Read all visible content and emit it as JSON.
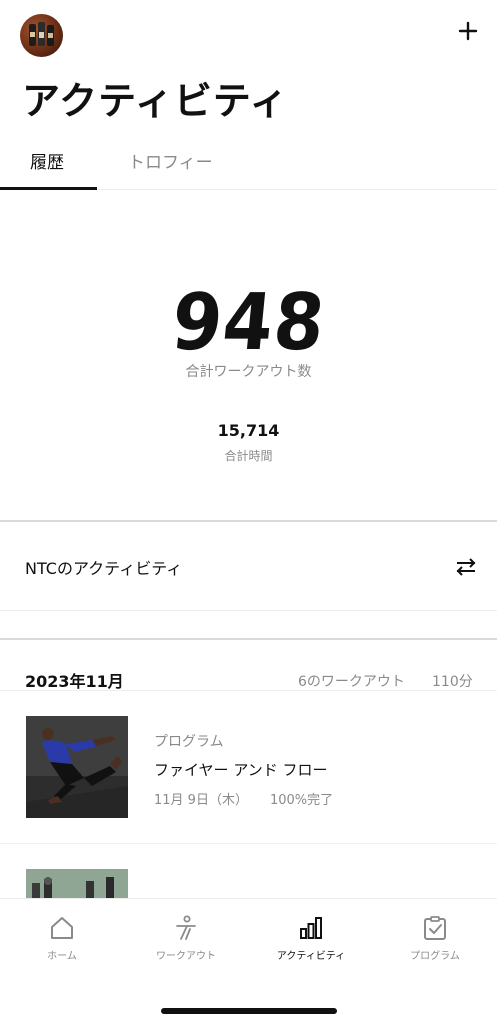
{
  "header": {
    "title": "アクティビティ",
    "add_icon": "plus-icon",
    "avatar_icon": "avatar"
  },
  "tabs": [
    {
      "label": "履歴",
      "active": true
    },
    {
      "label": "トロフィー",
      "active": false
    }
  ],
  "summary": {
    "total_workouts": "948",
    "total_workouts_label": "合計ワークアウト数",
    "total_time": "15,714",
    "total_time_label": "合計時間"
  },
  "ntc": {
    "label": "NTCのアクティビティ",
    "filter_icon": "filter-icon"
  },
  "month": {
    "title": "2023年11月",
    "workout_count": "6のワークアウト",
    "minutes": "110分"
  },
  "workouts": [
    {
      "category": "プログラム",
      "name": "ファイヤー アンド フロー",
      "date": "11月 9日（木）",
      "completion": "100%完了"
    }
  ],
  "tabbar": [
    {
      "label": "ホーム",
      "icon": "home-icon",
      "active": false
    },
    {
      "label": "ワークアウト",
      "icon": "runner-icon",
      "active": false
    },
    {
      "label": "アクティビティ",
      "icon": "bar-chart-icon",
      "active": true
    },
    {
      "label": "プログラム",
      "icon": "clipboard-check-icon",
      "active": false
    }
  ],
  "colors": {
    "text_primary": "#111111",
    "text_secondary": "#8a8a8a",
    "divider": "#dadada",
    "background": "#ffffff"
  }
}
